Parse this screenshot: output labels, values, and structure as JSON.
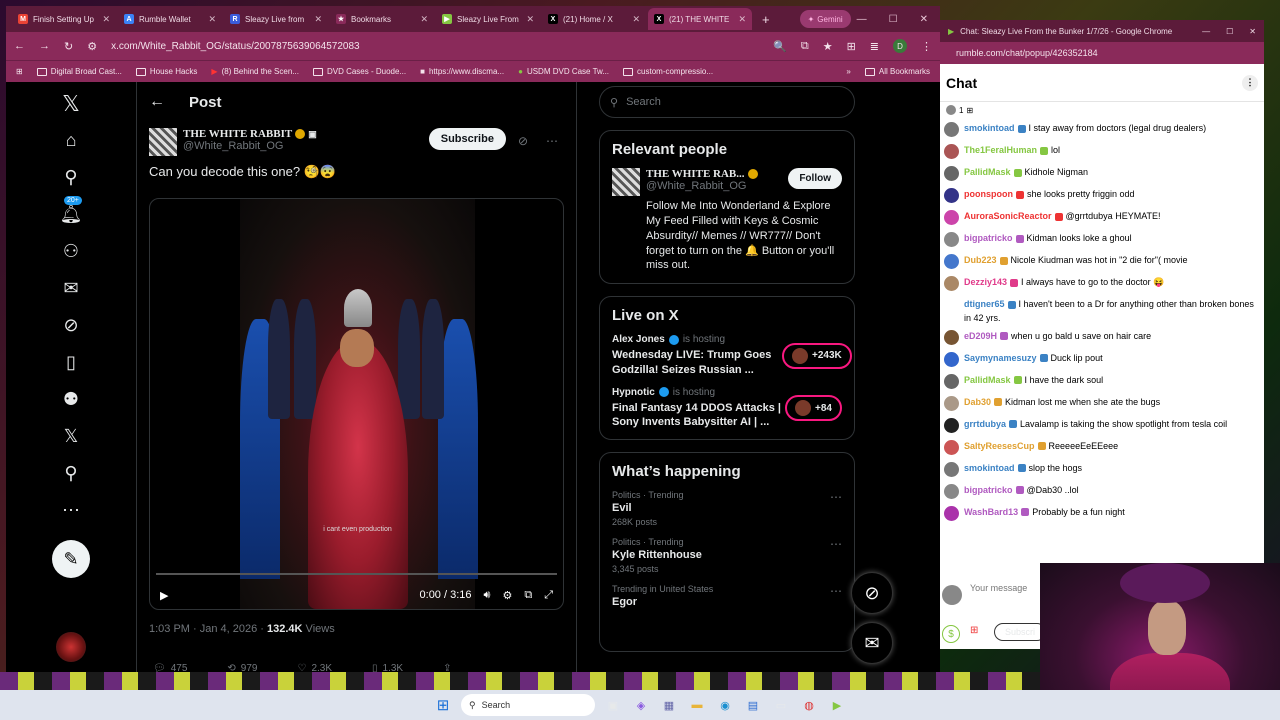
{
  "tabs": [
    {
      "label": "Finish Setting Up",
      "fav": "M",
      "color": "#ea4335"
    },
    {
      "label": "Rumble Wallet",
      "fav": "A",
      "color": "#3b82f6"
    },
    {
      "label": "Sleazy Live from",
      "fav": "R",
      "color": "#3b5bdb"
    },
    {
      "label": "Bookmarks",
      "fav": "★",
      "color": "#8a2a5a"
    },
    {
      "label": "Sleazy Live From",
      "fav": "▶",
      "color": "#85c742"
    },
    {
      "label": "(21) Home / X",
      "fav": "X",
      "color": "#000"
    },
    {
      "label": "(21) THE WHITE",
      "fav": "X",
      "color": "#000"
    }
  ],
  "gemini": "Gemini",
  "url": "x.com/White_Rabbit_OG/status/2007875639064572083",
  "bookmarks": [
    "Digital Broad Cast...",
    "House Hacks",
    "(8) Behind the Scen...",
    "DVD Cases - Duode...",
    "https://www.discma...",
    "USDM DVD Case Tw...",
    "custom-compressio...",
    "All Bookmarks"
  ],
  "x": {
    "header_title": "Post",
    "author_name": "THE WHITE RABBIT",
    "author_handle": "@White_Rabbit_OG",
    "subscribe": "Subscribe",
    "post_text": "Can you decode this one? 🧐😨",
    "badge": "20+",
    "video": {
      "caption": "i cant even production",
      "time": "0:00 / 3:16"
    },
    "meta_time": "1:03 PM · Jan 4, 2026 · ",
    "views_count": "132.4K",
    "views_label": " Views",
    "stats": {
      "replies": "475",
      "reposts": "979",
      "likes": "2.3K",
      "bookmarks": "1.3K"
    }
  },
  "sidebar": {
    "search_placeholder": "Search",
    "relevant_title": "Relevant people",
    "rp_name": "THE WHITE RAB...",
    "rp_handle": "@White_Rabbit_OG",
    "follow": "Follow",
    "rp_bio": "Follow Me Into Wonderland & Explore My Feed Filled with Keys & Cosmic Absurdity// Memes // WR777// Don't forget to turn on the 🔔 Button or you'll miss out.",
    "live_title": "Live on X",
    "live": [
      {
        "host": "Alex Jones",
        "status": "is hosting",
        "title": "Wednesday LIVE: Trump Goes Godzilla! Seizes Russian ...",
        "count": "+243K"
      },
      {
        "host": "Hypnotic",
        "status": "is hosting",
        "title": "Final Fantasy 14 DDOS Attacks | Sony Invents Babysitter AI | ...",
        "count": "+84"
      }
    ],
    "happening_title": "What’s happening",
    "trends": [
      {
        "cat": "Politics · Trending",
        "name": "Evil",
        "posts": "268K posts"
      },
      {
        "cat": "Politics · Trending",
        "name": "Kyle Rittenhouse",
        "posts": "3,345 posts"
      },
      {
        "cat": "Trending in United States",
        "name": "Egor",
        "posts": ""
      }
    ]
  },
  "chat": {
    "window_title": "Chat: Sleazy Live From the Bunker 1/7/26 - Google Chrome",
    "url": "rumble.com/chat/popup/426352184",
    "title": "Chat",
    "viewers": "1",
    "input_placeholder": "Your message",
    "subscribe": "Subscri",
    "messages": [
      {
        "user": "smokintoad",
        "color": "#3b82c4",
        "text": "I stay away from doctors (legal drug dealers)",
        "av": "#777"
      },
      {
        "user": "The1FeralHuman",
        "color": "#85c742",
        "text": "lol",
        "av": "#a55"
      },
      {
        "user": "PallidMask",
        "color": "#85c742",
        "text": "Kidhole Nigman",
        "av": "#666"
      },
      {
        "user": "poonspoon",
        "color": "#e33",
        "text": "she looks pretty friggin odd",
        "av": "#338"
      },
      {
        "user": "AuroraSonicReactor",
        "color": "#e33",
        "text": "@grrtdubya HEYMATE!",
        "av": "#c4a"
      },
      {
        "user": "bigpatricko",
        "color": "#b05ac0",
        "text": "Kidman looks loke a ghoul",
        "av": "#888"
      },
      {
        "user": "Dub223",
        "color": "#e0a030",
        "text": "Nicole Kiudman was hot in \"2 die for\"( movie",
        "av": "#47c"
      },
      {
        "user": "Dezziy143",
        "color": "#e03a8a",
        "text": "I always have to go to the doctor 😝",
        "av": "#a86"
      },
      {
        "user": "dtigner65",
        "color": "#3b82c4",
        "text": "I haven't been to a Dr for anything other than broken bones in 42 yrs.",
        "av": "#fff"
      },
      {
        "user": "eD209H",
        "color": "#b05ac0",
        "text": "when u go bald u save on hair care",
        "av": "#753"
      },
      {
        "user": "Saymynamesuzy",
        "color": "#3b82c4",
        "text": "Duck lip pout",
        "av": "#36c"
      },
      {
        "user": "PallidMask",
        "color": "#85c742",
        "text": "I have the dark soul",
        "av": "#666"
      },
      {
        "user": "Dab30",
        "color": "#e0a030",
        "text": "Kidman lost me when she ate the bugs",
        "av": "#a98"
      },
      {
        "user": "grrtdubya",
        "color": "#3b82c4",
        "text": "Lavalamp is taking the show spotlight from tesla coil",
        "av": "#222"
      },
      {
        "user": "SaltyReesesCup",
        "color": "#e0a030",
        "text": "ReeeeeEeEEeee",
        "av": "#c55"
      },
      {
        "user": "smokintoad",
        "color": "#3b82c4",
        "text": "slop the hogs",
        "av": "#777"
      },
      {
        "user": "bigpatricko",
        "color": "#b05ac0",
        "text": "@Dab30 ..lol",
        "av": "#888"
      },
      {
        "user": "WashBard13",
        "color": "#b05ac0",
        "text": "Probably be a fun night",
        "av": "#a3a"
      }
    ]
  },
  "taskbar": {
    "search": "Search"
  }
}
